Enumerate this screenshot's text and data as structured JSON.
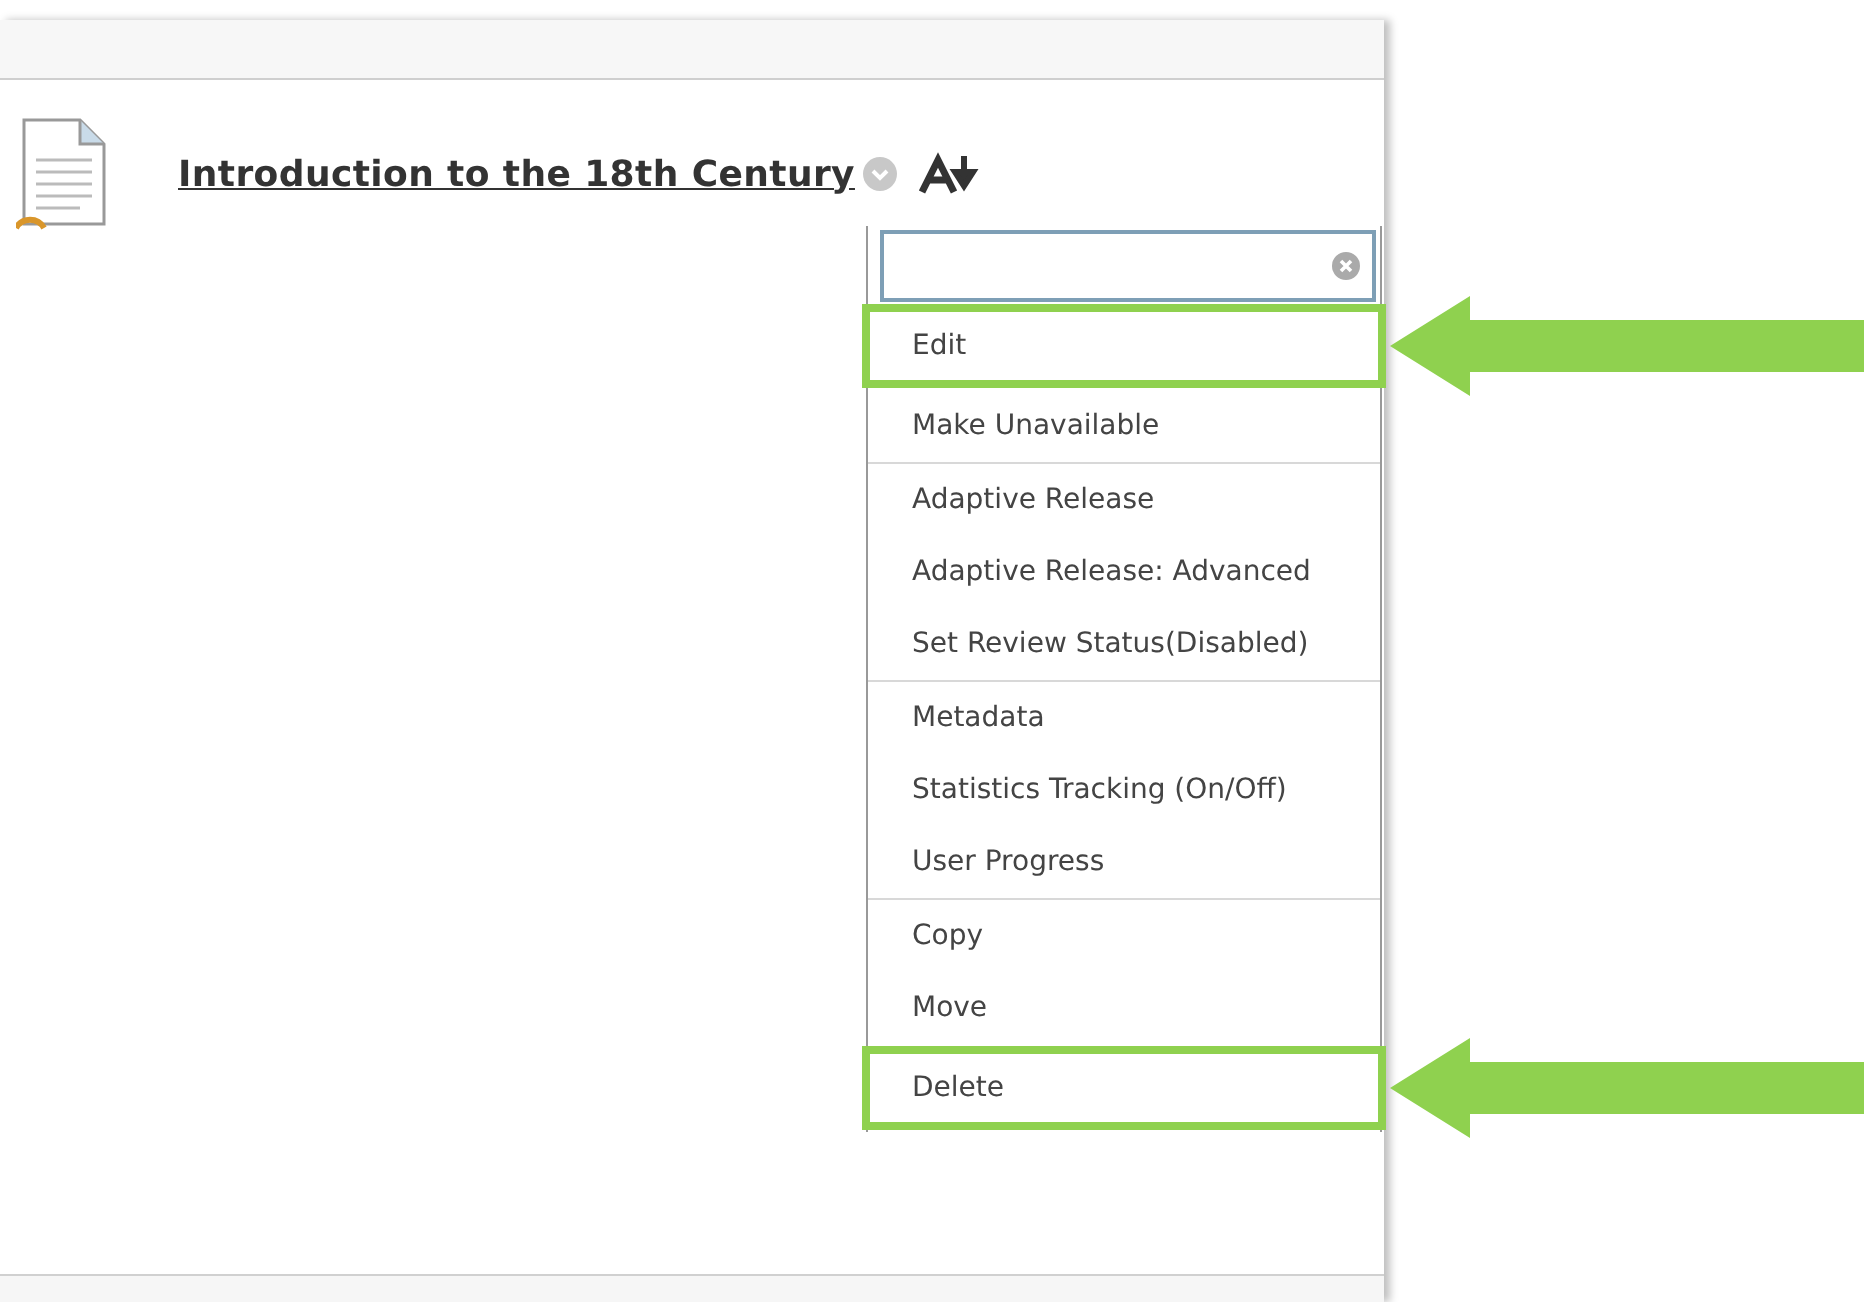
{
  "content_item": {
    "title": "Introduction to the 18th Century"
  },
  "menu": {
    "groups": [
      {
        "items": [
          {
            "label": "Edit",
            "highlighted": true
          },
          {
            "label": "Make Unavailable",
            "highlighted": false
          }
        ]
      },
      {
        "items": [
          {
            "label": "Adaptive Release",
            "highlighted": false
          },
          {
            "label": "Adaptive Release: Advanced",
            "highlighted": false
          },
          {
            "label": "Set Review Status(Disabled)",
            "highlighted": false
          }
        ]
      },
      {
        "items": [
          {
            "label": "Metadata",
            "highlighted": false
          },
          {
            "label": "Statistics Tracking (On/Off)",
            "highlighted": false
          },
          {
            "label": "User Progress",
            "highlighted": false
          }
        ]
      },
      {
        "items": [
          {
            "label": "Copy",
            "highlighted": false
          },
          {
            "label": "Move",
            "highlighted": false
          },
          {
            "label": "Delete",
            "highlighted": true
          }
        ]
      }
    ]
  }
}
